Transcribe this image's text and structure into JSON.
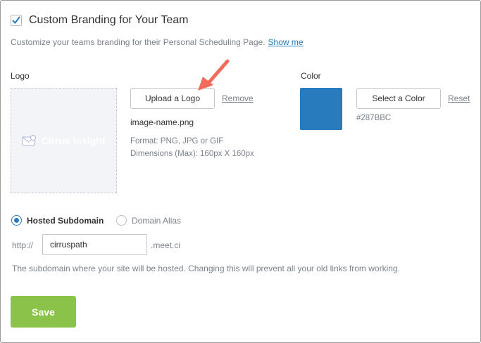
{
  "colors": {
    "accent": "#287BBC",
    "save_green": "#8BC34A",
    "arrow_red": "#F26B5B"
  },
  "header": {
    "checkbox_checked": true,
    "title": "Custom Branding for Your Team",
    "description": "Customize your teams branding for their Personal Scheduling Page.",
    "show_me_link": "Show me"
  },
  "logo": {
    "label": "Logo",
    "preview_text": "Cirrus Insight",
    "upload_button": "Upload a Logo",
    "remove_link": "Remove",
    "file_name": "image-name.png",
    "format_text": "Format: PNG, JPG or GIF",
    "dimensions_text": "Dimensions (Max): 160px X 160px",
    "icon": "envelope-icon"
  },
  "color": {
    "label": "Color",
    "select_button": "Select a Color",
    "reset_link": "Reset",
    "hex_value": "#287BBC"
  },
  "subdomain": {
    "option_hosted": "Hosted Subdomain",
    "option_alias": "Domain Alias",
    "selected": "Hosted Subdomain",
    "prefix": "http://",
    "value": "cirruspath",
    "suffix": ".meet.ci",
    "help_text": "The subdomain where your site will be hosted. Changing this will prevent all your old links from working."
  },
  "actions": {
    "save_label": "Save"
  }
}
